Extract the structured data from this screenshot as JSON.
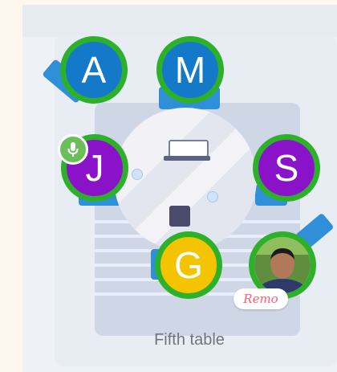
{
  "table": {
    "label": "Fifth table"
  },
  "seats": [
    {
      "initial": "A",
      "color": "#1479c9"
    },
    {
      "initial": "M",
      "color": "#1479c9"
    },
    {
      "initial": "J",
      "color": "#8a12c9"
    },
    {
      "initial": "S",
      "color": "#8a12c9"
    },
    {
      "initial": "G",
      "color": "#f5c400"
    }
  ],
  "ring_color": "#2db12a",
  "mic": {
    "icon": "microphone-icon"
  },
  "brand_badge": "Remo"
}
